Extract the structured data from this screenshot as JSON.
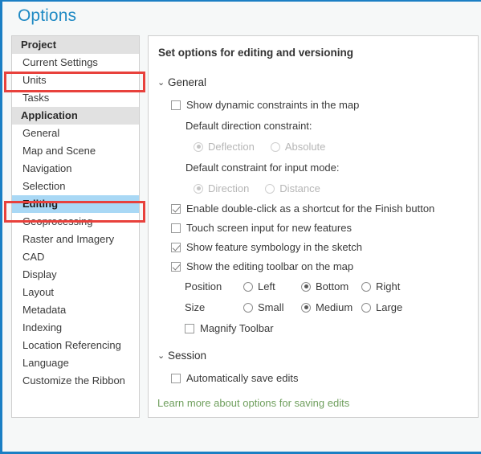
{
  "window": {
    "title": "Options",
    "accent_color": "#1b7fc4",
    "title_color": "#1f8ac4"
  },
  "sidebar": {
    "groups": [
      {
        "header": "Project",
        "items": [
          {
            "label": "Current Settings",
            "selected": false,
            "highlighted": false
          },
          {
            "label": "Units",
            "selected": false,
            "highlighted": true
          },
          {
            "label": "Tasks",
            "selected": false,
            "highlighted": false
          }
        ]
      },
      {
        "header": "Application",
        "items": [
          {
            "label": "General",
            "selected": false,
            "highlighted": false
          },
          {
            "label": "Map and Scene",
            "selected": false,
            "highlighted": false
          },
          {
            "label": "Navigation",
            "selected": false,
            "highlighted": false
          },
          {
            "label": "Selection",
            "selected": false,
            "highlighted": false
          },
          {
            "label": "Editing",
            "selected": true,
            "highlighted": true
          },
          {
            "label": "Geoprocessing",
            "selected": false,
            "highlighted": false
          },
          {
            "label": "Raster and Imagery",
            "selected": false,
            "highlighted": false
          },
          {
            "label": "CAD",
            "selected": false,
            "highlighted": false
          },
          {
            "label": "Display",
            "selected": false,
            "highlighted": false
          },
          {
            "label": "Layout",
            "selected": false,
            "highlighted": false
          },
          {
            "label": "Metadata",
            "selected": false,
            "highlighted": false
          },
          {
            "label": "Indexing",
            "selected": false,
            "highlighted": false
          },
          {
            "label": "Location Referencing",
            "selected": false,
            "highlighted": false
          },
          {
            "label": "Language",
            "selected": false,
            "highlighted": false
          },
          {
            "label": "Customize the Ribbon",
            "selected": false,
            "highlighted": false
          }
        ]
      }
    ],
    "selection_color": "#a9d8f5",
    "highlight_color": "#e8413c"
  },
  "main": {
    "title": "Set options for editing and versioning",
    "sections": {
      "general": {
        "label": "General",
        "chevron": "⌄",
        "show_dynamic_constraints": {
          "label": "Show dynamic constraints in the map",
          "checked": false
        },
        "default_direction_constraint": {
          "label": "Default direction constraint:",
          "enabled": false,
          "options": [
            {
              "label": "Deflection",
              "selected": true
            },
            {
              "label": "Absolute",
              "selected": false
            }
          ]
        },
        "default_input_mode_constraint": {
          "label": "Default constraint for input mode:",
          "enabled": false,
          "options": [
            {
              "label": "Direction",
              "selected": true
            },
            {
              "label": "Distance",
              "selected": false
            }
          ]
        },
        "enable_double_click": {
          "label": "Enable double-click as a shortcut for the Finish button",
          "checked": true
        },
        "touch_screen_input": {
          "label": "Touch screen input for new features",
          "checked": false
        },
        "show_feature_symbology": {
          "label": "Show feature symbology in the sketch",
          "checked": true
        },
        "show_editing_toolbar": {
          "label": "Show the editing toolbar on the map",
          "checked": true
        },
        "position": {
          "label": "Position",
          "options": [
            {
              "label": "Left",
              "selected": false
            },
            {
              "label": "Bottom",
              "selected": true
            },
            {
              "label": "Right",
              "selected": false
            }
          ]
        },
        "size": {
          "label": "Size",
          "options": [
            {
              "label": "Small",
              "selected": false
            },
            {
              "label": "Medium",
              "selected": true
            },
            {
              "label": "Large",
              "selected": false
            }
          ]
        },
        "magnify_toolbar": {
          "label": "Magnify Toolbar",
          "checked": false
        }
      },
      "session": {
        "label": "Session",
        "chevron": "⌄",
        "automatically_save_edits": {
          "label": "Automatically save edits",
          "checked": false
        }
      }
    },
    "learn_more_link": {
      "label": "Learn more about options for saving edits",
      "color": "#6f9f5d"
    }
  }
}
